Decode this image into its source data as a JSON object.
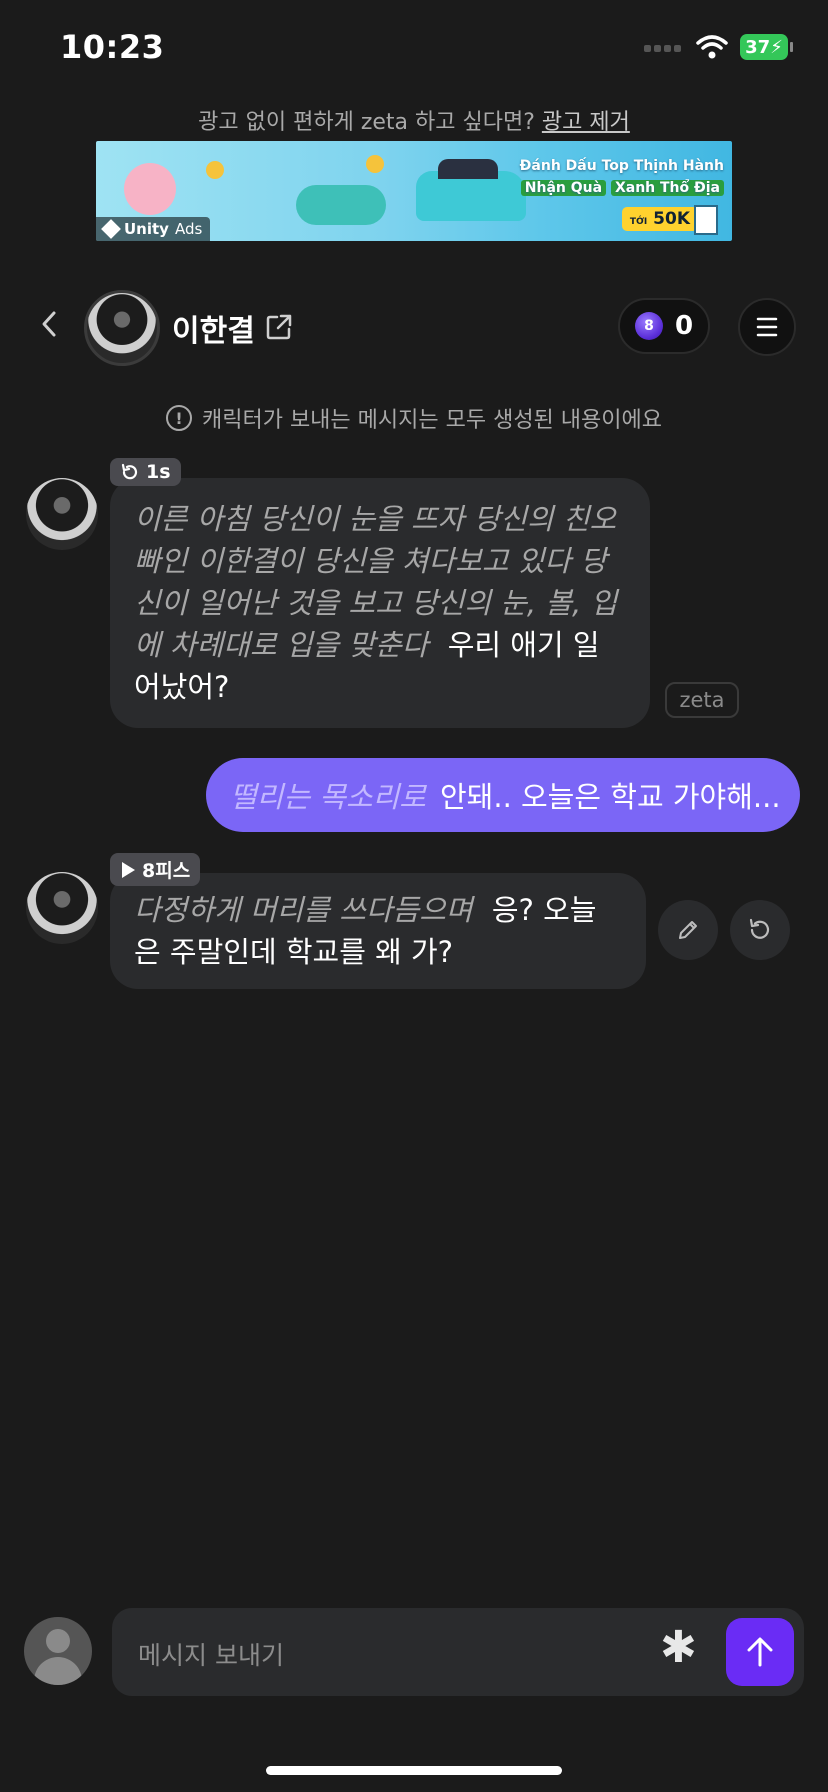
{
  "status": {
    "time": "10:23",
    "battery": "37"
  },
  "ad": {
    "prompt": "광고 없이 편하게 zeta 하고 싶다면?",
    "remove_link": "광고 제거",
    "headline_1": "Đánh Dấu Top Thịnh Hành",
    "headline_2a": "Nhận Quà",
    "headline_2b": "Xanh Thổ Địa",
    "prize_prefix": "TỚI",
    "prize": "50K",
    "brand": "Unity",
    "brand_suffix": "Ads"
  },
  "header": {
    "name": "이한결",
    "credits": "0",
    "coin_glyph": "8"
  },
  "notice": "캐릭터가 보내는 메시지는 모두 생성된 내용이에요",
  "messages": [
    {
      "role": "character",
      "tag": "1s",
      "action": "이른 아침 당신이 눈을 뜨자 당신의 친오빠인 이한결이 당신을 쳐다보고 있다 당신이 일어난 것을 보고 당신의 눈, 볼, 입에 차례대로 입을 맞춘다",
      "speech": "우리 애기 일어났어?",
      "label": "zeta"
    },
    {
      "role": "user",
      "action": "떨리는 목소리로",
      "speech": "안돼.. 오늘은 학교 가야해..."
    },
    {
      "role": "character",
      "tag": "8피스",
      "action": "다정하게 머리를 쓰다듬으며",
      "speech": "응? 오늘은 주말인데 학교를 왜 가?"
    }
  ],
  "input": {
    "placeholder": "메시지 보내기"
  },
  "icons": {
    "back": "chevron-left-icon",
    "external": "external-link-icon",
    "menu": "menu-icon",
    "info": "info-icon",
    "replay": "replay-icon",
    "play": "play-icon",
    "edit": "pencil-icon",
    "regenerate": "regenerate-icon",
    "asterisk": "asterisk-icon",
    "send": "arrow-up-icon"
  },
  "colors": {
    "background": "#1b1b1b",
    "user_bubble": "#7b66f6",
    "send_button": "#6a2cf5",
    "bubble": "#2a2b2d"
  }
}
